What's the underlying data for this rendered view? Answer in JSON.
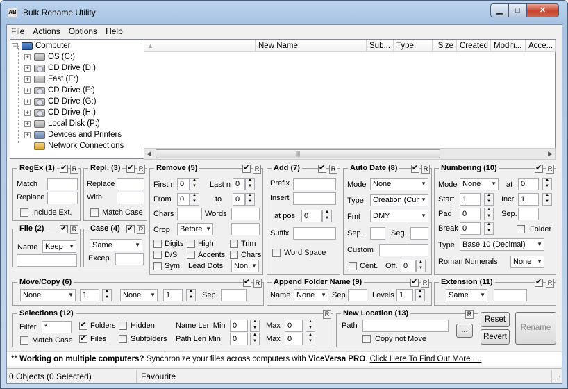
{
  "window": {
    "title": "Bulk Rename Utility",
    "icon": "AB",
    "min": "▁",
    "max": "□",
    "close": "✕"
  },
  "menu": [
    "File",
    "Actions",
    "Options",
    "Help"
  ],
  "tree": {
    "root": "Computer",
    "items": [
      "OS (C:)",
      "CD Drive (D:)",
      "Fast (E:)",
      "CD Drive (F:)",
      "CD Drive (G:)",
      "CD Drive (H:)",
      "Local Disk (P:)",
      "Devices and Printers",
      "Network Connections"
    ]
  },
  "list": {
    "columns": [
      "",
      "New Name",
      "Sub...",
      "Type",
      "Size",
      "Created",
      "Modifi...",
      "Acce..."
    ]
  },
  "regex": {
    "title": "RegEx (1)",
    "match_label": "Match",
    "replace_label": "Replace",
    "include_ext": "Include Ext.",
    "r": "R"
  },
  "repl": {
    "title": "Repl. (3)",
    "replace_label": "Replace",
    "with_label": "With",
    "match_case": "Match Case",
    "r": "R"
  },
  "remove": {
    "title": "Remove (5)",
    "first_n": "First n",
    "first_n_val": "0",
    "last_n": "Last n",
    "last_n_val": "0",
    "from": "From",
    "from_val": "0",
    "to": "to",
    "to_val": "0",
    "chars": "Chars",
    "words": "Words",
    "crop": "Crop",
    "crop_val": "Before",
    "digits": "Digits",
    "high": "High",
    "trim": "Trim",
    "ds": "D/S",
    "accents": "Accents",
    "chars2": "Chars",
    "sym": "Sym.",
    "lead_dots": "Lead Dots",
    "lead_val": "Non",
    "r": "R"
  },
  "add": {
    "title": "Add (7)",
    "prefix": "Prefix",
    "insert": "Insert",
    "at_pos": "at pos.",
    "at_pos_val": "0",
    "suffix": "Suffix",
    "word_space": "Word Space",
    "r": "R"
  },
  "autodate": {
    "title": "Auto Date (8)",
    "mode": "Mode",
    "mode_val": "None",
    "type": "Type",
    "type_val": "Creation (Cur",
    "fmt": "Fmt",
    "fmt_val": "DMY",
    "sep": "Sep.",
    "seg": "Seg.",
    "custom": "Custom",
    "cent": "Cent.",
    "off": "Off.",
    "off_val": "0",
    "r": "R"
  },
  "numbering": {
    "title": "Numbering (10)",
    "mode": "Mode",
    "mode_val": "None",
    "at": "at",
    "at_val": "0",
    "start": "Start",
    "start_val": "1",
    "incr": "Incr.",
    "incr_val": "1",
    "pad": "Pad",
    "pad_val": "0",
    "sep": "Sep.",
    "break": "Break",
    "break_val": "0",
    "folder": "Folder",
    "type": "Type",
    "type_val": "Base 10 (Decimal)",
    "roman": "Roman Numerals",
    "roman_val": "None",
    "r": "R"
  },
  "file": {
    "title": "File (2)",
    "name": "Name",
    "name_val": "Keep",
    "r": "R"
  },
  "case": {
    "title": "Case (4)",
    "case_val": "Same",
    "excep": "Excep.",
    "r": "R"
  },
  "movecopy": {
    "title": "Move/Copy (6)",
    "sel1": "None",
    "num1": "1",
    "sel2": "None",
    "num2": "1",
    "sep": "Sep.",
    "r": "R"
  },
  "appendfolder": {
    "title": "Append Folder Name (9)",
    "name": "Name",
    "name_val": "None",
    "sep": "Sep.",
    "levels": "Levels",
    "levels_val": "1",
    "r": "R"
  },
  "extension": {
    "title": "Extension (11)",
    "val": "Same",
    "r": "R"
  },
  "selections": {
    "title": "Selections (12)",
    "filter": "Filter",
    "filter_val": "*",
    "folders": "Folders",
    "hidden": "Hidden",
    "name_len_min": "Name Len Min",
    "nlmin_val": "0",
    "max": "Max",
    "nlmax_val": "0",
    "match_case": "Match Case",
    "files": "Files",
    "subfolders": "Subfolders",
    "path_len_min": "Path Len Min",
    "plmin_val": "0",
    "max2": "Max",
    "plmax_val": "0",
    "r": "R"
  },
  "newlocation": {
    "title": "New Location (13)",
    "path": "Path",
    "browse": "...",
    "copy_not_move": "Copy not Move",
    "r": "R"
  },
  "buttons": {
    "reset": "Reset",
    "revert": "Revert",
    "rename": "Rename"
  },
  "promo": {
    "stars": "**",
    "bold": "Working on multiple computers?",
    "text": " Synchronize your files across computers with ",
    "brand": "ViceVersa PRO",
    "dot": ". ",
    "link": "Click Here To Find Out More ...."
  },
  "status": {
    "objects": "0 Objects (0 Selected)",
    "favourite": "Favourite"
  }
}
